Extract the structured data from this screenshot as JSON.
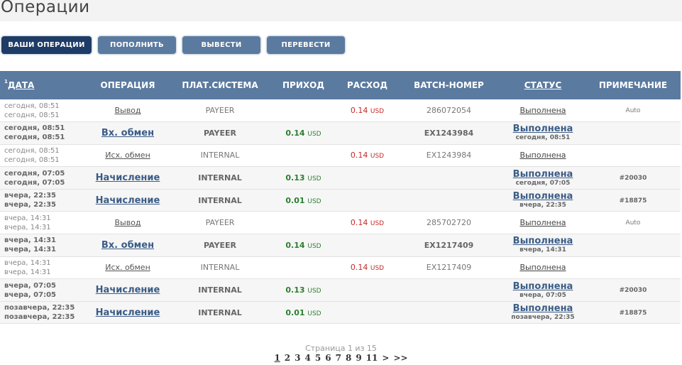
{
  "page": {
    "title": "Операции"
  },
  "buttons": [
    {
      "label": "ВАШИ ОПЕРАЦИИ",
      "active": true
    },
    {
      "label": "ПОПОЛНИТЬ",
      "active": false
    },
    {
      "label": "ВЫВЕСТИ",
      "active": false
    },
    {
      "label": "ПЕРЕВЕСТИ",
      "active": false
    }
  ],
  "table": {
    "headers": {
      "date_sort_index": "1",
      "date": "ДАТА",
      "operation": "ОПЕРАЦИЯ",
      "system": "ПЛАТ.СИСТЕМА",
      "income": "ПРИХОД",
      "expense": "РАСХОД",
      "batch": "BATCH-НОМЕР",
      "status": "СТАТУС",
      "note": "ПРИМЕЧАНИЕ"
    },
    "rows": [
      {
        "type": "out",
        "date1": "сегодня, 08:51",
        "date2": "сегодня, 08:51",
        "operation": "Вывод",
        "system": "PAYEER",
        "income": "",
        "income_cur": "",
        "expense": "0.14",
        "expense_cur": "USD",
        "batch": "286072054",
        "status": "Выполнена",
        "status_time": "",
        "note": "Auto"
      },
      {
        "type": "in",
        "date1": "сегодня, 08:51",
        "date2": "сегодня, 08:51",
        "operation": "Вх. обмен",
        "system": "PAYEER",
        "income": "0.14",
        "income_cur": "USD",
        "expense": "",
        "expense_cur": "",
        "batch": "EX1243984",
        "status": "Выполнена",
        "status_time": "сегодня, 08:51",
        "note": ""
      },
      {
        "type": "out",
        "date1": "сегодня, 08:51",
        "date2": "сегодня, 08:51",
        "operation": "Исх. обмен",
        "system": "INTERNAL",
        "income": "",
        "income_cur": "",
        "expense": "0.14",
        "expense_cur": "USD",
        "batch": "EX1243984",
        "status": "Выполнена",
        "status_time": "",
        "note": ""
      },
      {
        "type": "in",
        "date1": "сегодня, 07:05",
        "date2": "сегодня, 07:05",
        "operation": "Начисление",
        "system": "INTERNAL",
        "income": "0.13",
        "income_cur": "USD",
        "expense": "",
        "expense_cur": "",
        "batch": "",
        "status": "Выполнена",
        "status_time": "сегодня, 07:05",
        "note": "#20030"
      },
      {
        "type": "in",
        "date1": "вчера, 22:35",
        "date2": "вчера, 22:35",
        "operation": "Начисление",
        "system": "INTERNAL",
        "income": "0.01",
        "income_cur": "USD",
        "expense": "",
        "expense_cur": "",
        "batch": "",
        "status": "Выполнена",
        "status_time": "вчера, 22:35",
        "note": "#18875"
      },
      {
        "type": "out",
        "date1": "вчера, 14:31",
        "date2": "вчера, 14:31",
        "operation": "Вывод",
        "system": "PAYEER",
        "income": "",
        "income_cur": "",
        "expense": "0.14",
        "expense_cur": "USD",
        "batch": "285702720",
        "status": "Выполнена",
        "status_time": "",
        "note": "Auto"
      },
      {
        "type": "in",
        "date1": "вчера, 14:31",
        "date2": "вчера, 14:31",
        "operation": "Вх. обмен",
        "system": "PAYEER",
        "income": "0.14",
        "income_cur": "USD",
        "expense": "",
        "expense_cur": "",
        "batch": "EX1217409",
        "status": "Выполнена",
        "status_time": "вчера, 14:31",
        "note": ""
      },
      {
        "type": "out",
        "date1": "вчера, 14:31",
        "date2": "вчера, 14:31",
        "operation": "Исх. обмен",
        "system": "INTERNAL",
        "income": "",
        "income_cur": "",
        "expense": "0.14",
        "expense_cur": "USD",
        "batch": "EX1217409",
        "status": "Выполнена",
        "status_time": "",
        "note": ""
      },
      {
        "type": "in",
        "date1": "вчера, 07:05",
        "date2": "вчера, 07:05",
        "operation": "Начисление",
        "system": "INTERNAL",
        "income": "0.13",
        "income_cur": "USD",
        "expense": "",
        "expense_cur": "",
        "batch": "",
        "status": "Выполнена",
        "status_time": "вчера, 07:05",
        "note": "#20030"
      },
      {
        "type": "in",
        "date1": "позавчера, 22:35",
        "date2": "позавчера, 22:35",
        "operation": "Начисление",
        "system": "INTERNAL",
        "income": "0.01",
        "income_cur": "USD",
        "expense": "",
        "expense_cur": "",
        "batch": "",
        "status": "Выполнена",
        "status_time": "позавчера, 22:35",
        "note": "#18875"
      }
    ]
  },
  "pagination": {
    "info": "Страница 1 из 15",
    "current": "1",
    "pages": [
      "1",
      "2",
      "3",
      "4",
      "5",
      "6",
      "7",
      "8",
      "9",
      "11"
    ],
    "next": ">",
    "last": ">>"
  },
  "colors": {
    "header_bg": "#5a7aa0",
    "active_button": "#1e3c66",
    "income": "#2e7d32",
    "expense": "#c62828",
    "link": "#3b5c86"
  }
}
